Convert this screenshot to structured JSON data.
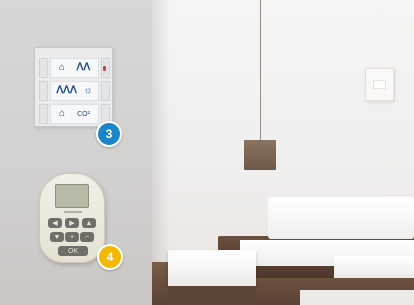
{
  "control_panel": {
    "rows": [
      {
        "left_icon": "house-icon",
        "right_icon": "two-people-icon"
      },
      {
        "left_icon": "group-people-icon",
        "right_icon": "temperature-icon"
      },
      {
        "left_icon": "home-alert-icon",
        "right_label": "CO²"
      }
    ],
    "led_color": "#c2454a"
  },
  "badges": {
    "control_panel_number": "3",
    "remote_number": "4",
    "badge_3_color": "#1b86c7",
    "badge_4_color": "#f5b800"
  },
  "remote": {
    "buttons": [
      "◀",
      "▶",
      "▲",
      "▼",
      "+",
      "−",
      "OK"
    ]
  }
}
